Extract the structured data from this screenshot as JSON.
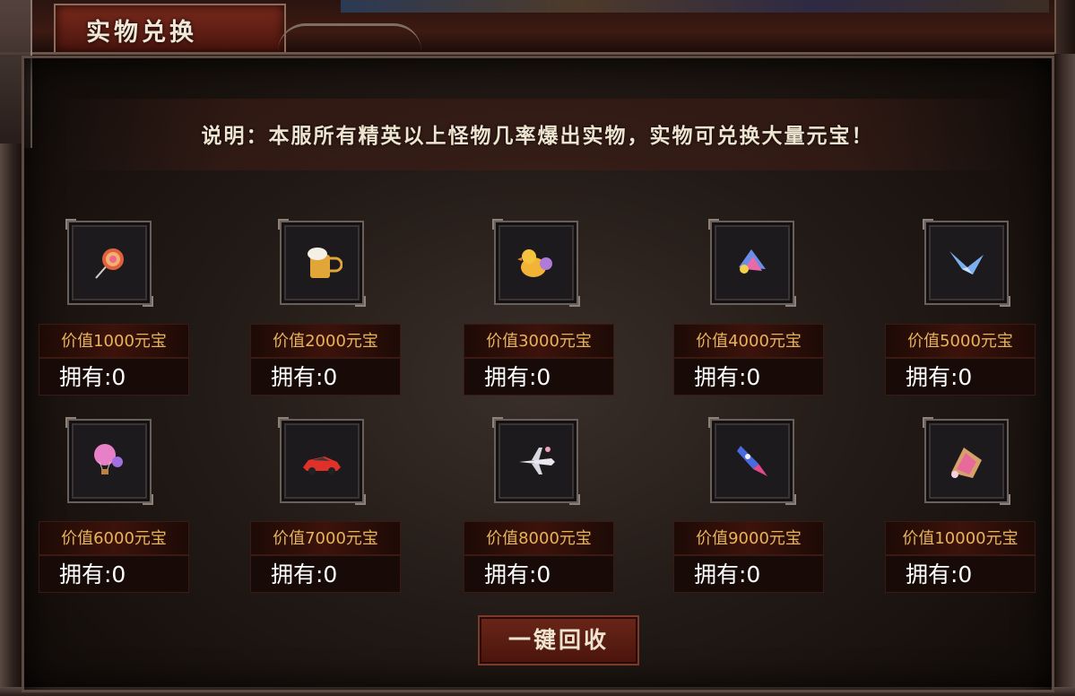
{
  "panel": {
    "title": "实物兑换",
    "description": "说明：本服所有精英以上怪物几率爆出实物，实物可兑换大量元宝！"
  },
  "items": [
    {
      "icon": "candy-icon",
      "value_label": "价值1000元宝",
      "owned_label": "拥有:0"
    },
    {
      "icon": "beer-mug-icon",
      "value_label": "价值2000元宝",
      "owned_label": "拥有:0"
    },
    {
      "icon": "duck-icon",
      "value_label": "价值3000元宝",
      "owned_label": "拥有:0"
    },
    {
      "icon": "crystal-fan-icon",
      "value_label": "价值4000元宝",
      "owned_label": "拥有:0"
    },
    {
      "icon": "paper-crane-icon",
      "value_label": "价值5000元宝",
      "owned_label": "拥有:0"
    },
    {
      "icon": "hot-air-balloon-icon",
      "value_label": "价值6000元宝",
      "owned_label": "拥有:0"
    },
    {
      "icon": "sports-car-icon",
      "value_label": "价值7000元宝",
      "owned_label": "拥有:0"
    },
    {
      "icon": "airplane-icon",
      "value_label": "价值8000元宝",
      "owned_label": "拥有:0"
    },
    {
      "icon": "rocket-icon",
      "value_label": "价值9000元宝",
      "owned_label": "拥有:0"
    },
    {
      "icon": "gift-box-icon",
      "value_label": "价值10000元宝",
      "owned_label": "拥有:0"
    }
  ],
  "actions": {
    "recycle_all": "一键回收"
  },
  "colors": {
    "value_text": "#e8b45a",
    "owned_text": "#ffffff",
    "title_tab": "#7a2a1c",
    "button": "#6a2619"
  }
}
